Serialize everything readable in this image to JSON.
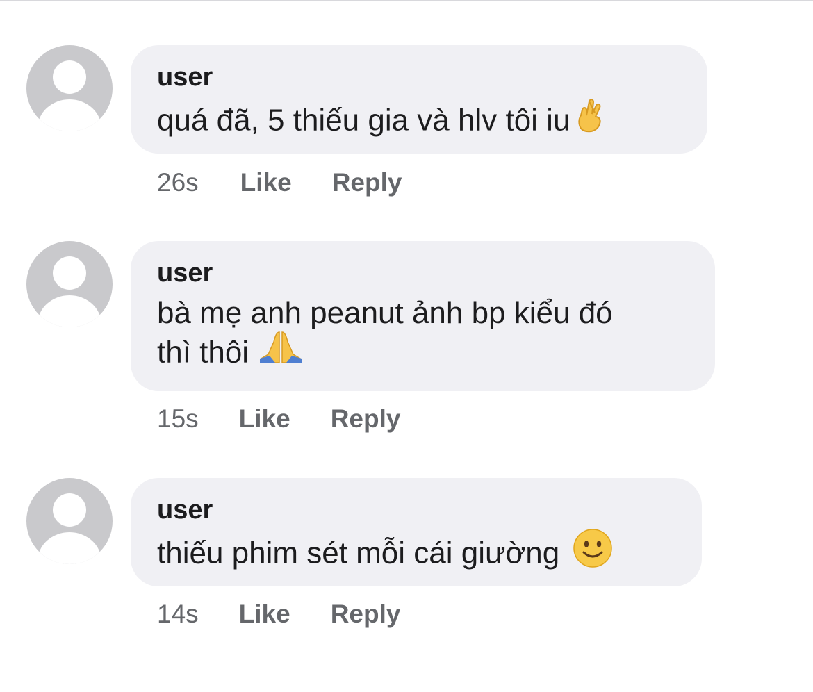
{
  "comments": [
    {
      "author": "user",
      "text": "quá đã, 5 thiếu gia và hlv tôi iu",
      "emoji": "crossed-fingers-emoji",
      "time": "26s",
      "like_label": "Like",
      "reply_label": "Reply"
    },
    {
      "author": "user",
      "text_line1": "bà mẹ anh peanut ảnh bp kiểu đó",
      "text_line2": "thì thôi",
      "emoji": "folded-hands-emoji",
      "time": "15s",
      "like_label": "Like",
      "reply_label": "Reply"
    },
    {
      "author": "user",
      "text": "thiếu phim sét mỗi cái giường",
      "emoji": "slightly-smiling-face-emoji",
      "time": "14s",
      "like_label": "Like",
      "reply_label": "Reply"
    }
  ],
  "colors": {
    "bubble": "#f0f0f4",
    "avatar": "#c9c9cc",
    "meta_text": "#65676b",
    "text": "#1c1c1e"
  }
}
